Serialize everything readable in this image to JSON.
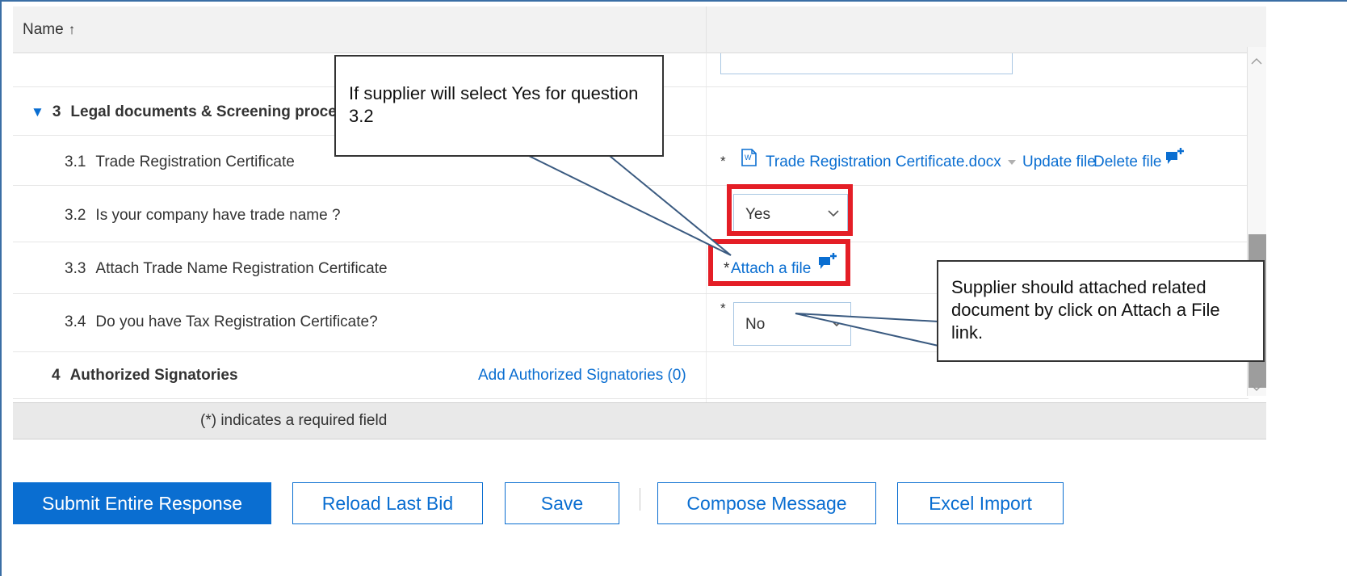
{
  "table": {
    "header_name": "Name",
    "sort_arrow": "↑"
  },
  "rows": {
    "section3": {
      "num": "3",
      "title": "Legal documents & Screening proces"
    },
    "q31": {
      "num": "3.1",
      "label": "Trade Registration Certificate",
      "required": "*",
      "file_name": "Trade Registration Certificate.docx",
      "update": "Update file",
      "delete": "Delete file"
    },
    "q32": {
      "num": "3.2",
      "label": "Is your company have trade name ?",
      "value": "Yes"
    },
    "q33": {
      "num": "3.3",
      "label": "Attach Trade Name Registration Certificate",
      "required": "*",
      "attach": "Attach a file"
    },
    "q34": {
      "num": "3.4",
      "label": "Do you have Tax Registration Certificate?",
      "required": "*",
      "value": "No"
    },
    "section4": {
      "num": "4",
      "title": "Authorized Signatories",
      "add_link": "Add Authorized Signatories (0)"
    }
  },
  "footer": {
    "note": "(*) indicates a required field"
  },
  "buttons": {
    "submit": "Submit Entire Response",
    "reload": "Reload Last Bid",
    "save": "Save",
    "compose": "Compose Message",
    "excel": "Excel Import"
  },
  "callouts": {
    "top": "If supplier will select Yes for question 3.2",
    "right": "Supplier should attached related document by click on Attach a File link."
  },
  "colors": {
    "accent": "#0a6ed1",
    "highlight": "#e41e26"
  },
  "icons": {
    "word_doc": "word-doc-icon",
    "comment_add": "comment-add-icon"
  }
}
